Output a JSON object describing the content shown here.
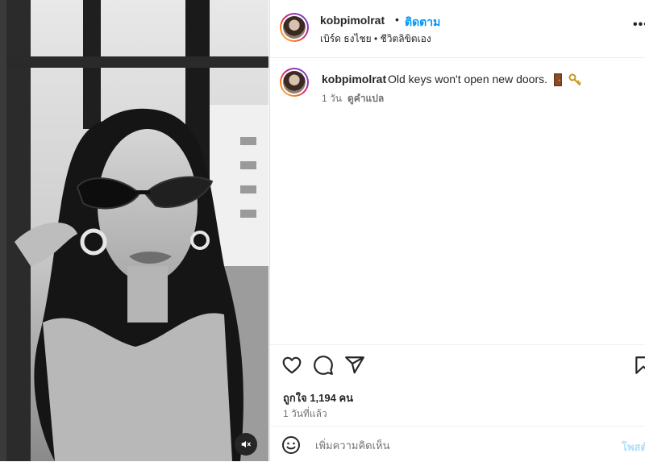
{
  "post": {
    "username": "kobpimolrat",
    "follow_label": "ติดตาม",
    "dot": "•",
    "audio_label": "เบิร์ด ธงไชย • ชีวิตลิขิตเอง",
    "more_icon": "more-horizontal-icon",
    "caption": {
      "username": "kobpimolrat",
      "text": "Old keys won't open new doors.",
      "emojis": [
        "door-emoji",
        "key-emoji"
      ],
      "time": "1 วัน",
      "translate_label": "ดูคำแปล"
    },
    "likes_label": "ถูกใจ 1,194 คน",
    "posted_label": "1 วันที่แล้ว",
    "comment_placeholder": "เพิ่มความคิดเห็น",
    "post_label": "โพสต์"
  },
  "icons": {
    "like": "heart-icon",
    "comment": "comment-icon",
    "share": "send-icon",
    "save": "bookmark-icon",
    "emoji": "smiley-icon",
    "mute": "speaker-muted-icon"
  },
  "colors": {
    "accent": "#0095f6",
    "text": "#262626",
    "secondary": "#737373",
    "post_disabled": "#b2dffc"
  }
}
